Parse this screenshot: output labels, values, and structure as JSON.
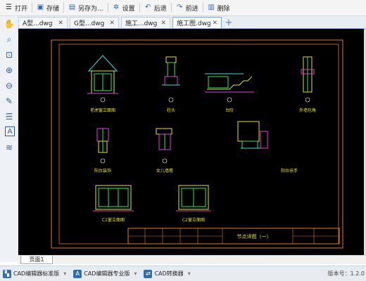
{
  "toolbar": {
    "items": [
      {
        "label": "打开",
        "icon": "open-menu-icon"
      },
      {
        "label": "存储",
        "icon": "save-icon"
      },
      {
        "label": "另存为...",
        "icon": "save-as-icon"
      },
      {
        "label": "设置",
        "icon": "gear-icon"
      },
      {
        "label": "后退",
        "icon": "back-arrow-icon"
      },
      {
        "label": "前进",
        "icon": "forward-arrow-icon"
      },
      {
        "label": "删除",
        "icon": "trash-icon"
      }
    ]
  },
  "tabs": [
    {
      "label": "A型...dwg",
      "close": "✕"
    },
    {
      "label": "G型...dwg",
      "close": "✕"
    },
    {
      "label": "施工...dwg",
      "close": "✕"
    },
    {
      "label": "施工图.dwg",
      "close": "✕",
      "active": true
    }
  ],
  "tab_add": "+",
  "left_tools": [
    "pan-icon",
    "zoom-window-icon",
    "zoom-region-icon",
    "zoom-in-icon",
    "zoom-out-icon",
    "measure-icon",
    "layers-icon",
    "text-icon",
    "layer-stack-icon"
  ],
  "drawing": {
    "labels": [
      "老虎窗立面图",
      "柱头",
      "台阶",
      "外墙包角",
      "阳台装饰",
      "女儿墙檐",
      "阳台扶手",
      "C1窗立面图",
      "C2窗立面图"
    ],
    "title_block": "节点详图（一）"
  },
  "page_tab": "页面1",
  "taskbar": {
    "items": [
      "CAD编辑器标准版",
      "CAD编辑器专业版",
      "CAD转换器"
    ],
    "version": "版本号：1.2.0"
  },
  "colors": {
    "canvas": "#000000",
    "frame": "#e07a2c",
    "line_cyan": "#37e0e0",
    "line_green": "#39e34a",
    "line_yellow": "#e6e13a",
    "line_magenta": "#e040e0",
    "accent": "#2e6fb3"
  }
}
